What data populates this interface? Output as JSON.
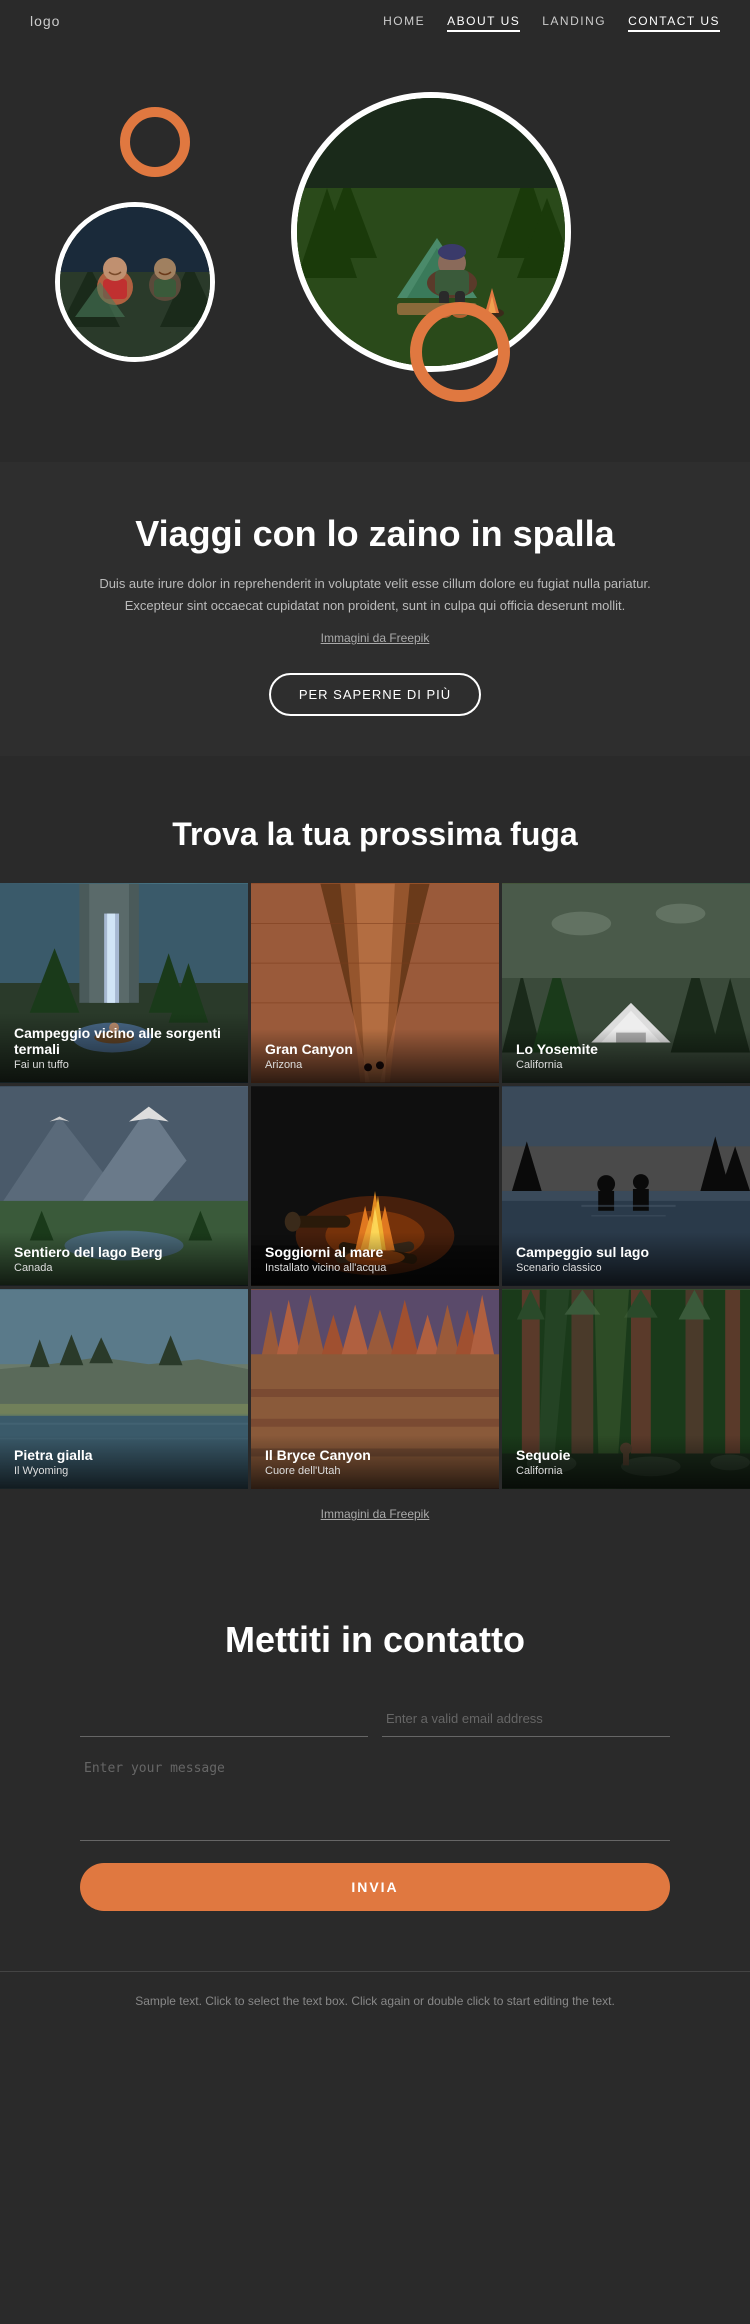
{
  "nav": {
    "logo": "logo",
    "links": [
      {
        "label": "HOME",
        "active": false
      },
      {
        "label": "ABOUT US",
        "active": true
      },
      {
        "label": "LANDING",
        "active": false
      },
      {
        "label": "CONTACT US",
        "active": false,
        "highlighted": true
      }
    ]
  },
  "hero": {
    "title": "Viaggi con lo zaino in spalla",
    "description": "Duis aute irure dolor in reprehenderit in voluptate velit esse cillum dolore eu fugiat nulla pariatur. Excepteur sint occaecat cupidatat non proident, sunt in culpa qui officia deserunt mollit.",
    "freepik_text": "Immagini da Freepik",
    "button_label": "PER SAPERNE DI PIÙ"
  },
  "destinations": {
    "title": "Trova la tua prossima fuga",
    "freepik_text": "Immagini da Freepik",
    "items": [
      {
        "title": "Campeggio vicino alle sorgenti termali",
        "subtitle": "Fai un tuffo",
        "bg": "waterfall"
      },
      {
        "title": "Gran Canyon",
        "subtitle": "Arizona",
        "bg": "canyon"
      },
      {
        "title": "Lo Yosemite",
        "subtitle": "California",
        "bg": "yosemite"
      },
      {
        "title": "Sentiero del lago Berg",
        "subtitle": "Canada",
        "bg": "mountains"
      },
      {
        "title": "Soggiorni al mare",
        "subtitle": "Installato vicino all'acqua",
        "bg": "fire"
      },
      {
        "title": "Campeggio sul lago",
        "subtitle": "Scenario classico",
        "bg": "lake"
      },
      {
        "title": "Pietra gialla",
        "subtitle": "Il Wyoming",
        "bg": "yellow"
      },
      {
        "title": "Il Bryce Canyon",
        "subtitle": "Cuore dell'Utah",
        "bg": "bryce"
      },
      {
        "title": "Sequoie",
        "subtitle": "California",
        "bg": "sequoia"
      }
    ]
  },
  "contact": {
    "title": "Mettiti in contatto",
    "name_placeholder": "",
    "email_placeholder": "Enter a valid email address",
    "message_placeholder": "Enter your message",
    "submit_label": "INVIA"
  },
  "footer": {
    "text": "Sample text. Click to select the text box. Click again or double click to start editing the text."
  }
}
